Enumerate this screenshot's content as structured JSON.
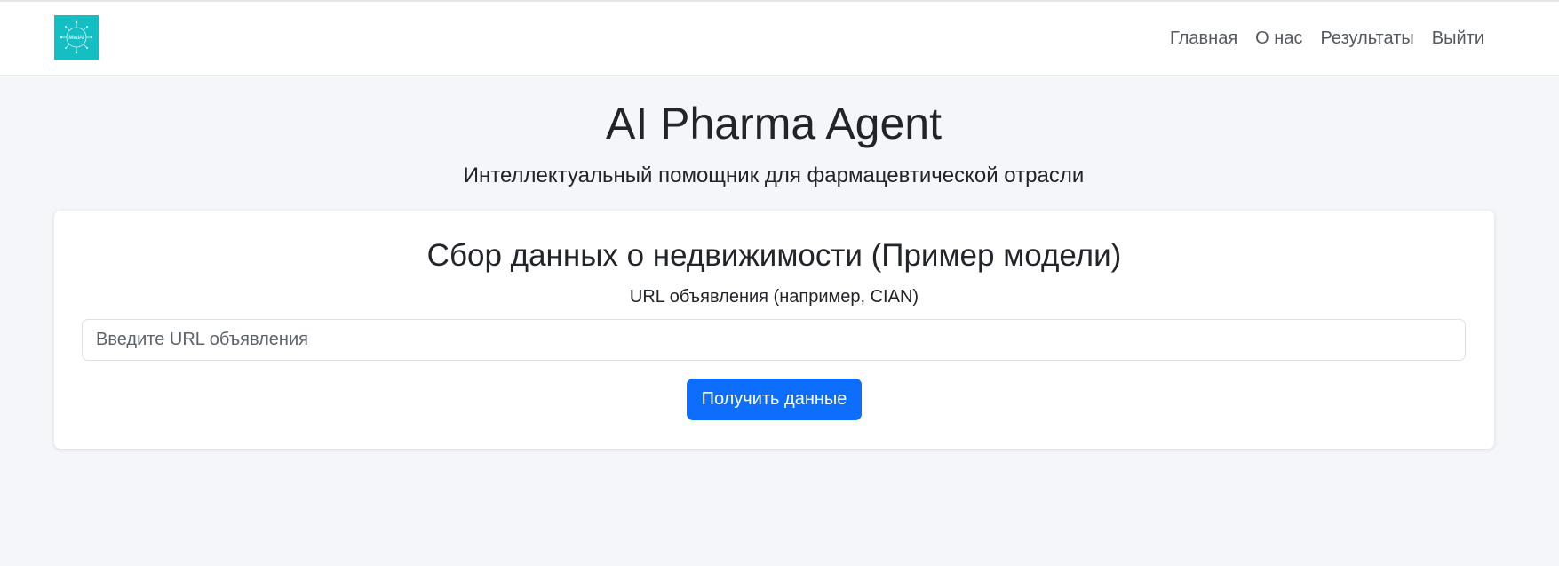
{
  "brand": {
    "logo_text": "MedAI",
    "logo_icon": "medical-network-logo",
    "logo_bg_color": "#14bfc4"
  },
  "nav": {
    "items": [
      {
        "label": "Главная"
      },
      {
        "label": "О нас"
      },
      {
        "label": "Результаты"
      },
      {
        "label": "Выйти"
      }
    ]
  },
  "hero": {
    "title": "AI Pharma Agent",
    "subtitle": "Интеллектуальный помощник для фармацевтической отрасли"
  },
  "form": {
    "title": "Сбор данных о недвижимости (Пример модели)",
    "url_label": "URL объявления (например, CIAN)",
    "url_placeholder": "Введите URL объявления",
    "url_value": "",
    "submit_label": "Получить данные",
    "accent_color": "#0d6efd"
  }
}
